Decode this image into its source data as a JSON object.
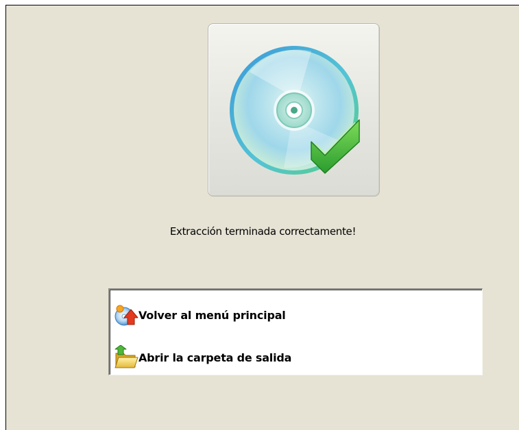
{
  "status": {
    "message": "Extracción terminada correctamente!"
  },
  "illustration": {
    "icon": "cd-check-icon"
  },
  "actions": [
    {
      "label": "Volver al menú principal",
      "icon": "home-back-icon"
    },
    {
      "label": "Abrir la carpeta de salida",
      "icon": "open-folder-icon"
    }
  ],
  "colors": {
    "panel_background": "#e6e3d5",
    "checkmark_green": "#3aa83a",
    "disc_blue": "#5aaee8"
  }
}
